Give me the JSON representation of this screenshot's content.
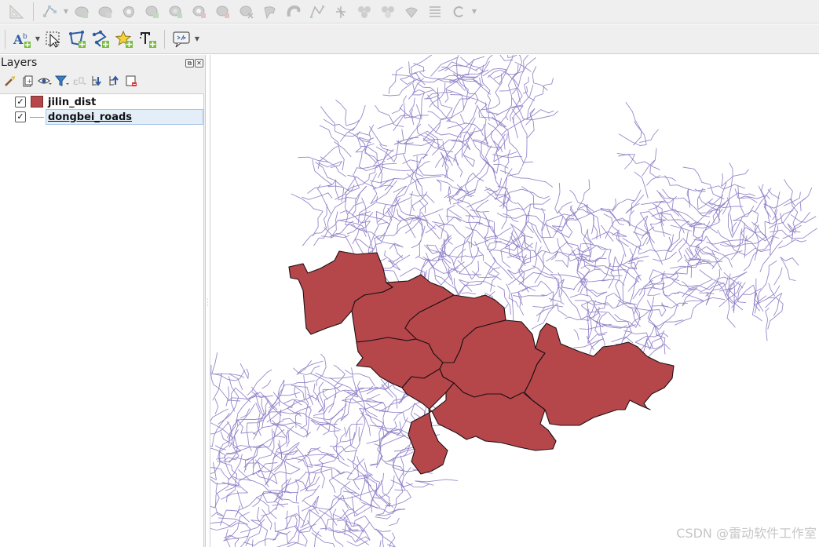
{
  "toolbar_top": {
    "tools": [
      {
        "icon": "measure-icon"
      },
      {
        "icon": "node-tool-icon",
        "dropdown": true
      },
      {
        "icon": "rotate-feature-icon"
      },
      {
        "icon": "simplify-feature-icon"
      },
      {
        "icon": "add-ring-icon"
      },
      {
        "icon": "add-part-icon"
      },
      {
        "icon": "fill-ring-icon"
      },
      {
        "icon": "delete-ring-icon"
      },
      {
        "icon": "delete-part-icon"
      },
      {
        "icon": "reshape-features-icon"
      },
      {
        "icon": "offset-curve-icon"
      },
      {
        "icon": "split-features-icon"
      },
      {
        "icon": "split-parts-icon"
      },
      {
        "icon": "merge-features-icon"
      },
      {
        "icon": "merge-attributes-icon"
      },
      {
        "icon": "rotate-point-symbols-icon"
      },
      {
        "icon": "offset-point-symbols-icon"
      },
      {
        "icon": "reverse-line-icon",
        "dropdown": true
      }
    ]
  },
  "toolbar_second": {
    "tools": [
      {
        "icon": "label-tool-icon",
        "dropdown": true
      },
      {
        "icon": "select-features-icon"
      },
      {
        "icon": "add-polygon-icon"
      },
      {
        "icon": "add-line-icon"
      },
      {
        "icon": "add-point-icon"
      },
      {
        "icon": "add-text-annotation-icon"
      },
      {
        "icon": "annotation-tool-icon",
        "dropdown": true
      }
    ]
  },
  "layers_panel": {
    "title": "Layers",
    "header_buttons": [
      "float-icon",
      "close-icon"
    ],
    "tools": [
      {
        "icon": "style-layer-icon"
      },
      {
        "icon": "add-group-icon"
      },
      {
        "icon": "visibility-eye-icon",
        "dropdown": true
      },
      {
        "icon": "filter-legend-icon",
        "dropdown": true
      },
      {
        "icon": "filter-expression-icon",
        "dropdown": true
      },
      {
        "icon": "expand-all-icon"
      },
      {
        "icon": "collapse-all-icon"
      },
      {
        "icon": "remove-layer-icon"
      }
    ],
    "layers": [
      {
        "name": "jilin_dist",
        "checked": true,
        "check_mark": "✓",
        "symbol": "polygon",
        "color": "#b5474b"
      },
      {
        "name": "dongbei_roads",
        "checked": true,
        "check_mark": "✓",
        "symbol": "line",
        "color": "#9a9ab8",
        "selected": true
      }
    ]
  },
  "map": {
    "district_color": "#b5474b",
    "road_color": "#8c7cc4"
  },
  "watermark": "CSDN @雷动软件工作室"
}
